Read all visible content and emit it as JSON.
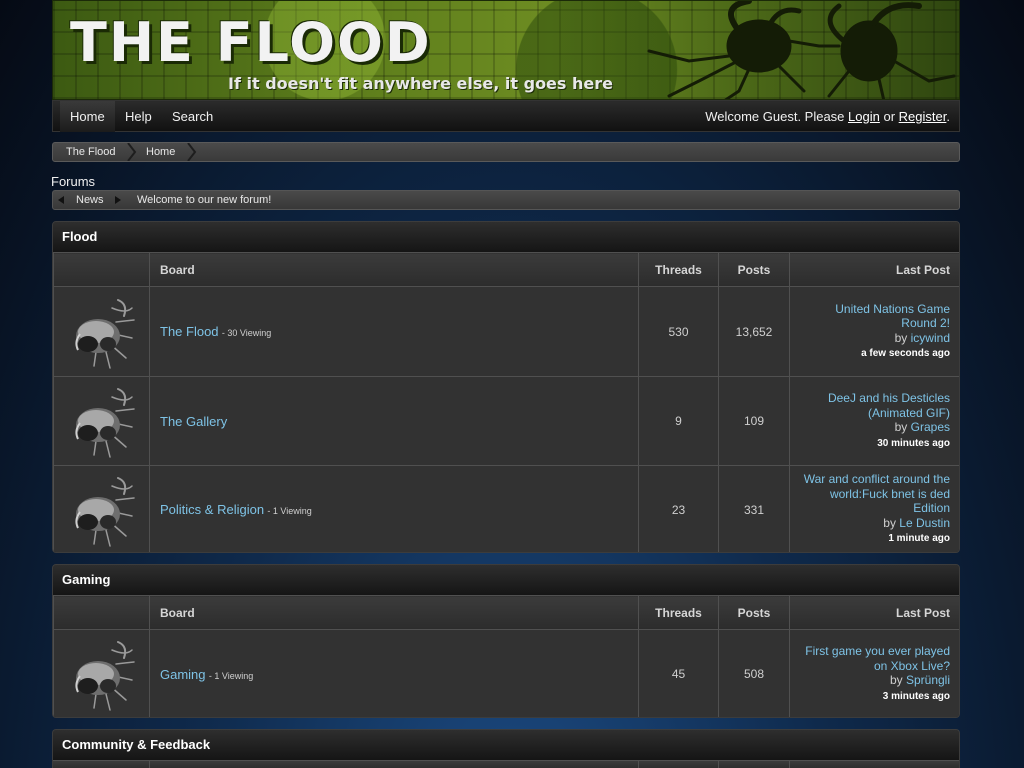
{
  "banner": {
    "title": "THE FLOOD",
    "tagline": "If it doesn't fit anywhere else, it goes here"
  },
  "nav": {
    "items": [
      {
        "label": "Home"
      },
      {
        "label": "Help"
      },
      {
        "label": "Search"
      }
    ],
    "welcome_prefix": "Welcome Guest. Please",
    "login": "Login",
    "or": "or",
    "register": "Register",
    "period": "."
  },
  "breadcrumb": [
    "The Flood",
    "Home"
  ],
  "forums_label": "Forums",
  "news": {
    "label": "News",
    "text": "Welcome to our new forum!"
  },
  "table_headers": {
    "board": "Board",
    "threads": "Threads",
    "posts": "Posts",
    "last_post": "Last Post"
  },
  "categories": [
    {
      "name": "Flood",
      "boards": [
        {
          "name": "The Flood",
          "viewing": "- 30 Viewing",
          "threads": "530",
          "posts": "13,652",
          "last_lines": [
            "United Nations Game",
            "Round 2!"
          ],
          "by": "by",
          "user": "icywind",
          "time": "a few seconds ago"
        },
        {
          "name": "The Gallery",
          "viewing": "",
          "threads": "9",
          "posts": "109",
          "last_lines": [
            "DeeJ and his Desticles",
            "(Animated GIF)"
          ],
          "by": "by",
          "user": "Grapes",
          "time": "30 minutes ago"
        },
        {
          "name": "Politics & Religion",
          "viewing": "- 1 Viewing",
          "threads": "23",
          "posts": "331",
          "last_lines": [
            "War and conflict around the",
            "world:Fuck bnet is ded",
            "Edition"
          ],
          "by": "by",
          "user": "Le Dustin",
          "time": "1 minute ago"
        }
      ]
    },
    {
      "name": "Gaming",
      "boards": [
        {
          "name": "Gaming",
          "viewing": "- 1 Viewing",
          "threads": "45",
          "posts": "508",
          "last_lines": [
            "First game you ever played",
            "on Xbox Live?"
          ],
          "by": "by",
          "user": "Sprüngli",
          "time": "3 minutes ago"
        }
      ]
    },
    {
      "name": "Community & Feedback",
      "boards": []
    }
  ],
  "colors": {
    "link": "#7ec3e6",
    "banner_green": "#5f7f1c"
  },
  "icons": {
    "board_icon": "flood-creature-icon"
  }
}
